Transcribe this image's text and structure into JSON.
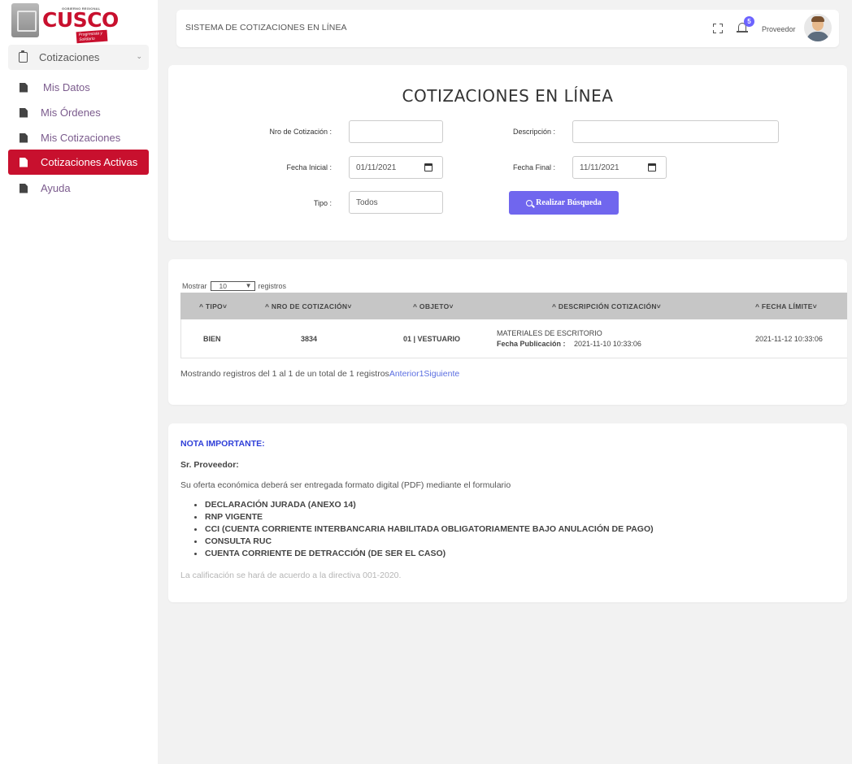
{
  "logo": {
    "small": "GOBIERNO REGIONAL",
    "name": "CUSCO",
    "tag": "Progresista y Solidario"
  },
  "sidebar": {
    "parent": {
      "label": "Cotizaciones"
    },
    "items": [
      {
        "label": "Mis Datos"
      },
      {
        "label": "Mis Órdenes"
      },
      {
        "label": "Mis Cotizaciones"
      },
      {
        "label": "Cotizaciones Activas"
      },
      {
        "label": "Ayuda"
      }
    ]
  },
  "topbar": {
    "title": "SISTEMA DE COTIZACIONES EN LÍNEA",
    "notifications": "5",
    "user": "Proveedor"
  },
  "search": {
    "title": "COTIZACIONES EN LÍNEA",
    "nro_label": "Nro de Cotización :",
    "nro_value": "",
    "desc_label": "Descripción :",
    "desc_value": "",
    "fecha_ini_label": "Fecha Inicial :",
    "fecha_ini_value": "01/11/2021",
    "fecha_fin_label": "Fecha Final :",
    "fecha_fin_value": "11/11/2021",
    "tipo_label": "Tipo :",
    "tipo_value": "Todos",
    "button": "Realizar Búsqueda"
  },
  "table": {
    "show_prefix": "Mostrar",
    "show_value": "10",
    "show_suffix": "registros",
    "headers": [
      "^ TIPO˅",
      "^ NRO DE COTIZACIÓN˅",
      "^ OBJETO˅",
      "^ DESCRIPCIÓN COTIZACIÓN˅",
      "^ FECHA LÍMITE˅"
    ],
    "rows": [
      {
        "tipo": "BIEN",
        "nro": "3834",
        "objeto": "01 | VESTUARIO",
        "descripcion": "MATERIALES DE ESCRITORIO",
        "pub_label": "Fecha Publicación :",
        "pub_value": "2021-11-10 10:33:06",
        "limite": "2021-11-12 10:33:06"
      }
    ],
    "info": "Mostrando registros del 1 al 1 de un total de 1 registros",
    "prev": "Anterior",
    "page": "1",
    "next": "Siguiente"
  },
  "note": {
    "title": "NOTA IMPORTANTE:",
    "salutation": "Sr. Proveedor:",
    "intro": "Su oferta económica deberá ser entregada formato digital (PDF) mediante el formulario",
    "items": [
      "DECLARACIÓN JURADA (ANEXO 14)",
      "RNP VIGENTE",
      "CCI (CUENTA CORRIENTE INTERBANCARIA HABILITADA OBLIGATORIAMENTE BAJO ANULACIÓN DE PAGO)",
      "CONSULTA RUC",
      "CUENTA CORRIENTE DE DETRACCIÓN (DE SER EL CASO)"
    ],
    "footer": "La calificación se hará de acuerdo a la directiva 001-2020."
  },
  "colors": {
    "brand_red": "#c8102e",
    "accent": "#7066ee",
    "link": "#5b6ee1",
    "note_title": "#2f3fd8"
  }
}
